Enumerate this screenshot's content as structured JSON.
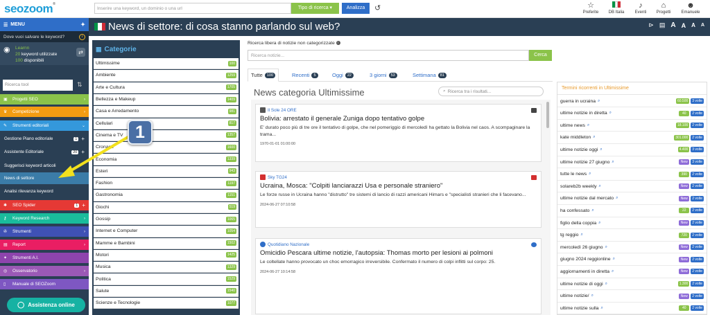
{
  "app": {
    "logo": "seozoom",
    "logo_mark": "®"
  },
  "topbar": {
    "search_placeholder": "Inserire una keyword, un dominio o una url",
    "type_button": "Tipo di ricerca ▾",
    "analyze_button": "Analizza",
    "icons": [
      {
        "name": "favorites",
        "label": "Preferite",
        "glyph": "☆"
      },
      {
        "name": "db-italia",
        "label": "DB Italia",
        "glyph": "▮"
      },
      {
        "name": "events",
        "label": "Eventi",
        "glyph": "🔔"
      },
      {
        "name": "projects",
        "label": "Progetti",
        "glyph": "⌂"
      },
      {
        "name": "user",
        "label": "Emanuele",
        "glyph": "👤"
      }
    ]
  },
  "sidebar": {
    "menu_label": "MENU",
    "save_keyword_prompt": "Dove vuoi salvare le keyword?",
    "learn": {
      "title": "Learnn",
      "used_count": "20",
      "used_label": "keyword utilizzate",
      "available_count": "100",
      "available_label": "disponibili"
    },
    "tool_search_placeholder": "Ricerca tool",
    "nav_items": [
      {
        "label": "Progetti SEO",
        "color": "#8bc34a"
      },
      {
        "label": "Competizione",
        "color": "#f39c12"
      },
      {
        "label": "Strumenti editoriali",
        "color": "#3498db"
      }
    ],
    "sub_items": [
      {
        "label": "Gestione Piano editoriale",
        "badge": "1",
        "plus": "+"
      },
      {
        "label": "Assistente Editoriale",
        "badge": "20",
        "plus": "+"
      },
      {
        "label": "Suggerisci keyword articoli",
        "badge": "",
        "plus": ""
      },
      {
        "label": "News di settore",
        "badge": "",
        "plus": ""
      },
      {
        "label": "Analisi rilevanza keyword",
        "badge": "",
        "plus": ""
      }
    ],
    "nav_items_2": [
      {
        "label": "SEO Spider",
        "color": "#e53935",
        "badge": "1"
      },
      {
        "label": "Keyword Research",
        "color": "#1abc9c"
      },
      {
        "label": "Strumenti",
        "color": "#3f51b5"
      },
      {
        "label": "Report",
        "color": "#e91e63"
      },
      {
        "label": "Strumenti A.I.",
        "color": "#8e44ad"
      },
      {
        "label": "Osservatorio",
        "color": "#9b59b6"
      },
      {
        "label": "Manuale di SEOZoom",
        "color": "#7e57c2"
      }
    ],
    "assist_label": "Assistenza online"
  },
  "page": {
    "title": "News di settore: di cosa stanno parlando sul web?",
    "tools": [
      "A",
      "A",
      "A",
      "A"
    ]
  },
  "categories": {
    "title": "Categorie",
    "items": [
      {
        "name": "Ultimissime",
        "count": "100"
      },
      {
        "name": "Ambiente",
        "count": "1259"
      },
      {
        "name": "Arte e Cultura",
        "count": "1705"
      },
      {
        "name": "Bellezza e Makeup",
        "count": "1409"
      },
      {
        "name": "Casa e Arredamento",
        "count": "981"
      },
      {
        "name": "Cellulari",
        "count": "817"
      },
      {
        "name": "Cinema e TV",
        "count": "1357"
      },
      {
        "name": "Cronaca",
        "count": "1600"
      },
      {
        "name": "Economia",
        "count": "1339"
      },
      {
        "name": "Esteri",
        "count": "943"
      },
      {
        "name": "Fashion",
        "count": "1197"
      },
      {
        "name": "Gastronomia",
        "count": "1151"
      },
      {
        "name": "Giochi",
        "count": "519"
      },
      {
        "name": "Gossip",
        "count": "1065"
      },
      {
        "name": "Internet e Computer",
        "count": "1054"
      },
      {
        "name": "Mamme e Bambini",
        "count": "1502"
      },
      {
        "name": "Motori",
        "count": "1425"
      },
      {
        "name": "Musica",
        "count": "1329"
      },
      {
        "name": "Politica",
        "count": "1529"
      },
      {
        "name": "Salute",
        "count": "1540"
      },
      {
        "name": "Scienze e Tecnologie",
        "count": "1077"
      }
    ]
  },
  "free_search": {
    "label": "Ricerca libera di notizie non categorizzate",
    "placeholder": "Ricerca notizie...",
    "button": "Cerca"
  },
  "tabs": [
    {
      "label": "Tutte",
      "count": "100",
      "active": true
    },
    {
      "label": "Recenti",
      "count": "5",
      "active": false
    },
    {
      "label": "Oggi",
      "count": "22",
      "active": false
    },
    {
      "label": "3 giorni",
      "count": "53",
      "active": false
    },
    {
      "label": "Settimana",
      "count": "81",
      "active": false
    }
  ],
  "news": {
    "section_title": "News categoria Ultimissime",
    "search_placeholder": "Ricerca tra i risultati...",
    "articles": [
      {
        "source": "Il Sole 24 ORE",
        "headline": "Bolivia: arrestato il generale Zuniga dopo tentativo golpe",
        "summary": "E' durato poco più di tre ore il tentativo di golpe, che nel pomeriggio di mercoledì ha gettato la Bolivia nel caos. A scompaginare la trama...",
        "date": "1970-01-01 01:00:00"
      },
      {
        "source": "Sky TG24",
        "headline": "Ucraina, Mosca: \"Colpiti lanciarazzi Usa e personale straniero\"",
        "summary": "Le forze russe in Ucraina hanno \"distrutto\" tre sistemi di lancio di razzi americani Himars e \"specialisti stranieri che li facevano...",
        "date": "2024-06-27 07:10:58"
      },
      {
        "source": "Quotidiano Nazionale",
        "headline": "Omicidio Pescara ultime notizie, l'autopsia: Thomas morto per lesioni ai polmoni",
        "summary": "Le coltellate hanno provocato un choc emorragico irreversibile. Confermato il numero di colpi inflitti sul corpo: 25.",
        "date": "2024-06-27 10:14:58"
      }
    ]
  },
  "terms": {
    "title": "Termini ricorrenti in Ultimissime",
    "rows": [
      {
        "term": "guerra in ucraina",
        "value": "60.500",
        "type": "green",
        "times": "3 volte"
      },
      {
        "term": "ultime notizie in diretta",
        "value": "40",
        "type": "green",
        "times": "2 volte"
      },
      {
        "term": "ultime news",
        "value": "18.100",
        "type": "green",
        "times": "2 volte"
      },
      {
        "term": "kate middleton",
        "value": "301.000",
        "type": "green",
        "times": "2 volte"
      },
      {
        "term": "ultime notizie oggi",
        "value": "4.400",
        "type": "green",
        "times": "3 volte"
      },
      {
        "term": "ultime notizie 27 giugno",
        "value": "New",
        "type": "purple",
        "times": "3 volte"
      },
      {
        "term": "tutte le news",
        "value": "390",
        "type": "green",
        "times": "2 volte"
      },
      {
        "term": "solareb2b weekly",
        "value": "New",
        "type": "purple",
        "times": "2 volte"
      },
      {
        "term": "ultime notizie dal mercato",
        "value": "New",
        "type": "purple",
        "times": "2 volte"
      },
      {
        "term": "ha confessato",
        "value": "22",
        "type": "green",
        "times": "2 volte"
      },
      {
        "term": "figlio della coppia",
        "value": "New",
        "type": "purple",
        "times": "2 volte"
      },
      {
        "term": "tg reggio",
        "value": "720",
        "type": "green",
        "times": "2 volte"
      },
      {
        "term": "mercoledì 26 giugno",
        "value": "New",
        "type": "purple",
        "times": "2 volte"
      },
      {
        "term": "giugno 2024 reggionline",
        "value": "New",
        "type": "purple",
        "times": "2 volte"
      },
      {
        "term": "aggiornamenti in diretta",
        "value": "New",
        "type": "purple",
        "times": "2 volte"
      },
      {
        "term": "ultime notizie di oggi",
        "value": "1.300",
        "type": "green",
        "times": "2 volte"
      },
      {
        "term": "ultime notizie/",
        "value": "New",
        "type": "purple",
        "times": "2 volte"
      },
      {
        "term": "ultime notizie sulla",
        "value": "40",
        "type": "green",
        "times": "2 volte"
      }
    ]
  },
  "annotation": {
    "step": "1"
  },
  "colors": {
    "dark_panel": "#2a3f54",
    "accent_blue": "#2f6ec8",
    "accent_green": "#8bc34a",
    "highlight_arrow": "#f2e01d"
  }
}
